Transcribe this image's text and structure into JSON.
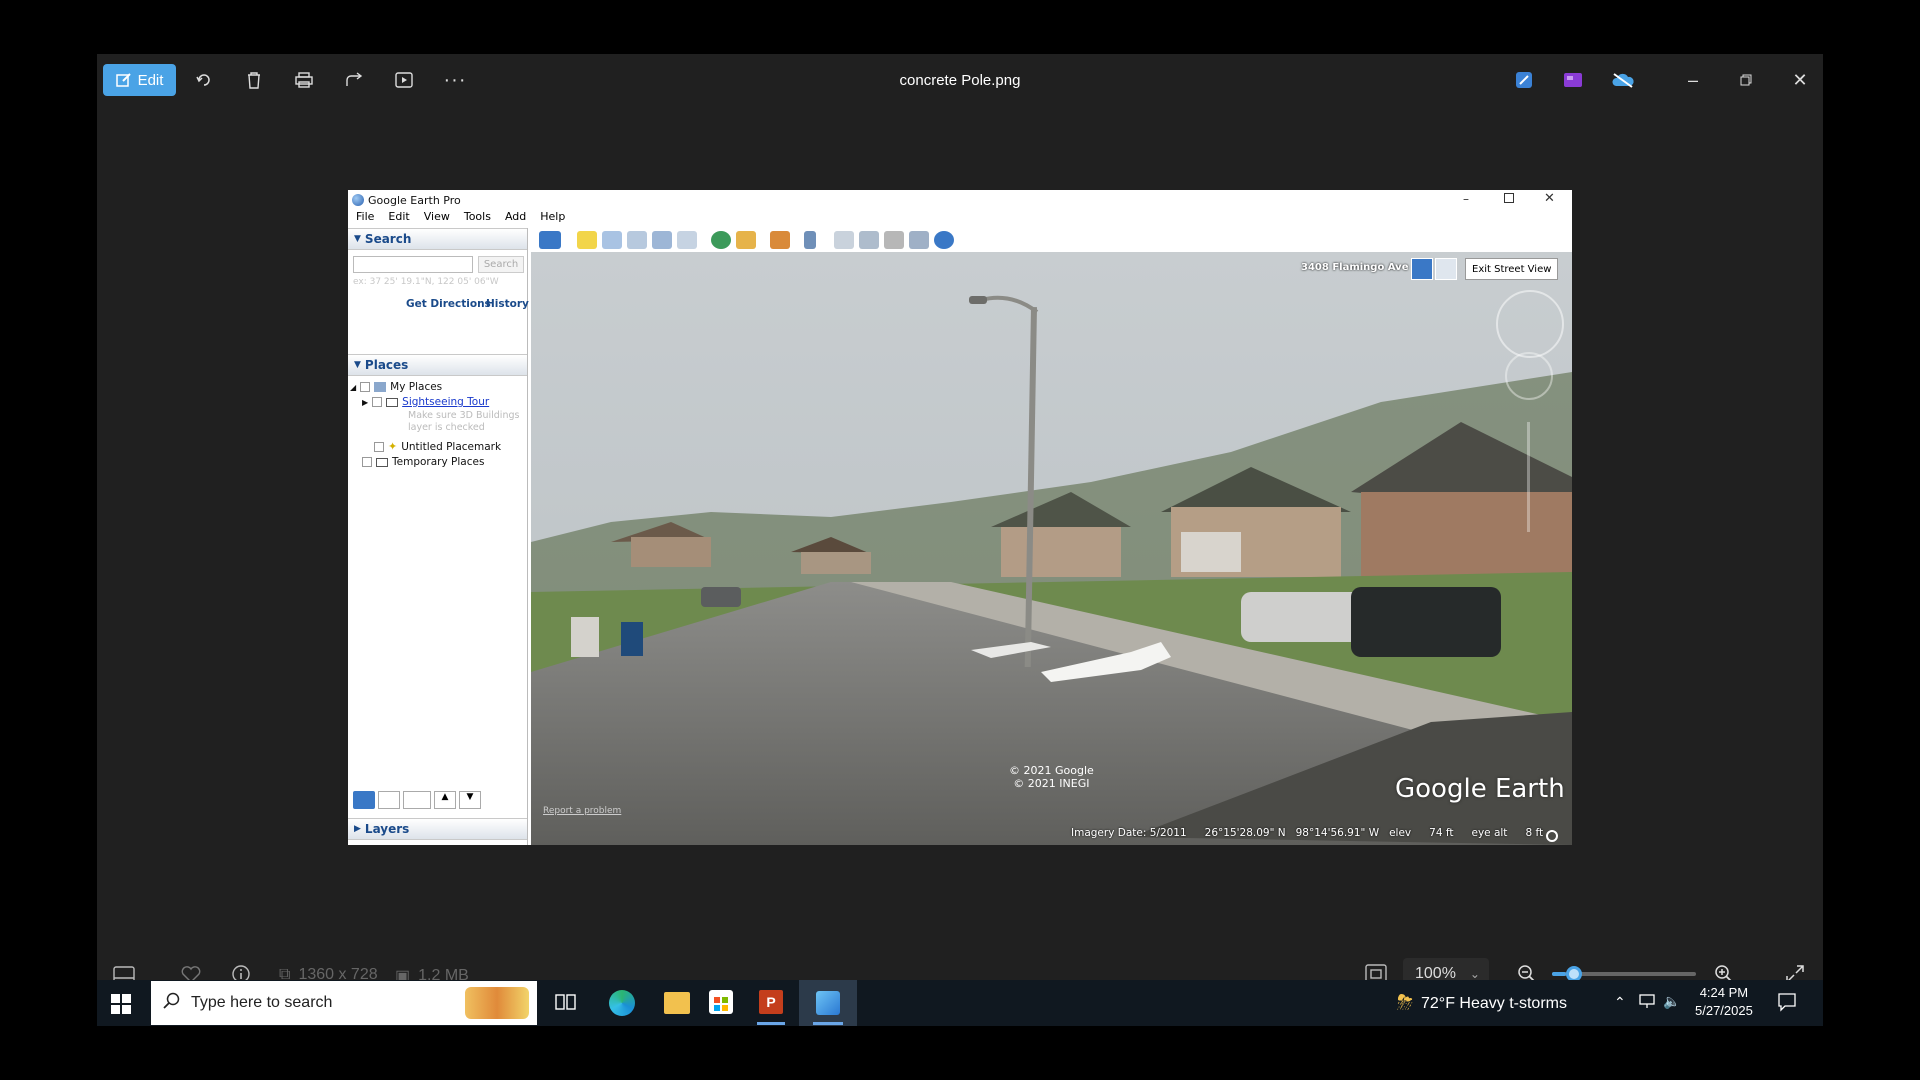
{
  "photos_app": {
    "edit_label": "Edit",
    "title": "concrete Pole.png",
    "dimensions": "1360 x 728",
    "file_size": "1.2 MB",
    "zoom": "100%",
    "zoom_slider_value": 0.1
  },
  "google_earth": {
    "window_title": "Google Earth Pro",
    "menu": [
      "File",
      "Edit",
      "View",
      "Tools",
      "Add",
      "Help"
    ],
    "search": {
      "header": "Search",
      "button": "Search",
      "hint": "ex: 37 25' 19.1\"N, 122 05' 06\"W",
      "get_directions": "Get Directions",
      "history": "History"
    },
    "places": {
      "header": "Places",
      "my_places": "My Places",
      "sightseeing_tour": "Sightseeing Tour",
      "tour_note": "Make sure 3D Buildings layer is checked",
      "untitled_placemark": "Untitled Placemark",
      "temporary_places": "Temporary Places"
    },
    "layers_header": "Layers",
    "street_view": {
      "address": "3408 Flamingo Ave",
      "exit_button": "Exit Street View",
      "copyright_1": "© 2021 Google",
      "copyright_2": "© 2021 INEGI",
      "report_problem": "Report a problem",
      "brand": "Google Earth"
    },
    "status": {
      "imagery_date": "Imagery Date: 5/2011",
      "lat": "26°15'28.09\" N",
      "lon": "98°14'56.91\" W",
      "elev_label": "elev",
      "elev": "74 ft",
      "eye_label": "eye alt",
      "eye_alt": "8 ft"
    }
  },
  "taskbar": {
    "search_placeholder": "Type here to search",
    "weather": "72°F  Heavy t-storms",
    "time": "4:24 PM",
    "date": "5/27/2025"
  }
}
